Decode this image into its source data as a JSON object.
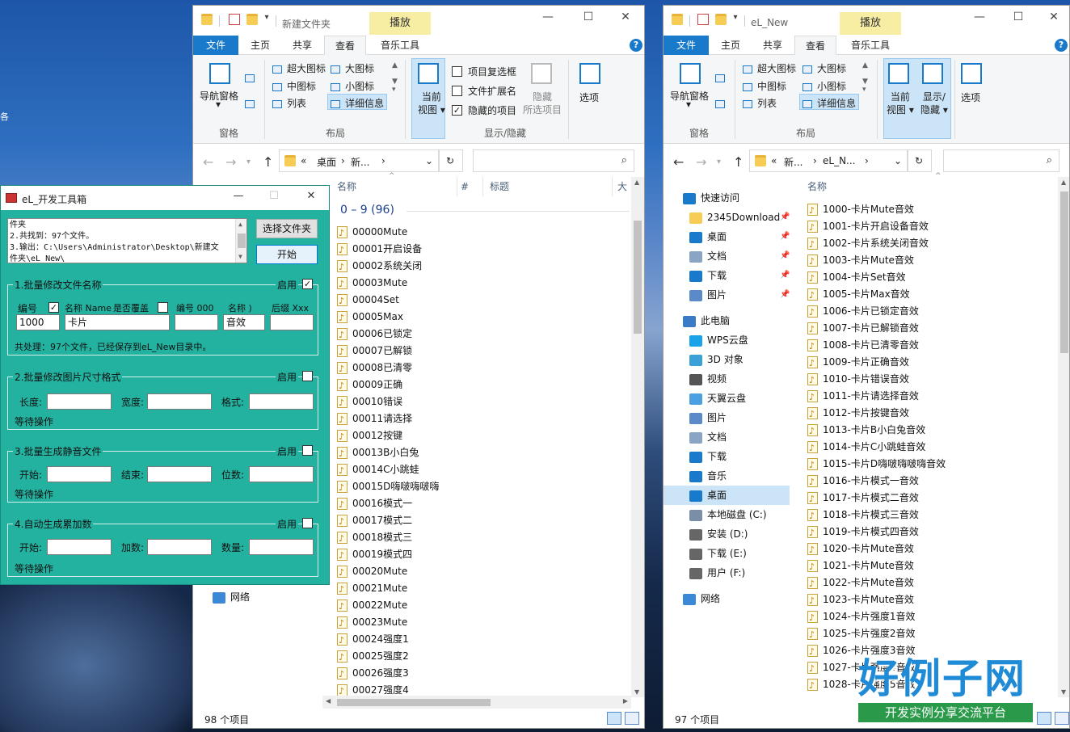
{
  "desktop": {
    "glyph": "各"
  },
  "explorer_left": {
    "title": "新建文件夹",
    "context_tab": "播放",
    "tabs": [
      "文件",
      "主页",
      "共享",
      "查看",
      "音乐工具"
    ],
    "ribbon": {
      "nav_pane": "导航窗格",
      "layout": [
        "超大图标",
        "大图标",
        "中图标",
        "小图标",
        "列表",
        "详细信息"
      ],
      "current_view": [
        "当前",
        "视图"
      ],
      "checkboxes": [
        "项目复选框",
        "文件扩展名",
        "隐藏的项目"
      ],
      "hide_selected": [
        "隐藏",
        "所选项目"
      ],
      "options": "选项",
      "groups": [
        "窗格",
        "布局",
        "显示/隐藏"
      ]
    },
    "breadcrumb": [
      "«",
      "桌面",
      "新..."
    ],
    "columns": [
      "名称",
      "#",
      "标题",
      "大"
    ],
    "group_header": "0 – 9 (96)",
    "files": [
      "00000Mute",
      "00001开启设备",
      "00002系统关闭",
      "00003Mute",
      "00004Set",
      "00005Max",
      "00006已锁定",
      "00007已解锁",
      "00008已清零",
      "00009正确",
      "00010错误",
      "00011请选择",
      "00012按键",
      "00013B小白兔",
      "00014C小跳蛙",
      "00015D嗨啵嗨啵嗨",
      "00016模式一",
      "00017模式二",
      "00018模式三",
      "00019模式四",
      "00020Mute",
      "00021Mute",
      "00022Mute",
      "00023Mute",
      "00024强度1",
      "00025强度2",
      "00026强度3",
      "00027强度4"
    ],
    "nav_network": "网络",
    "status": "98 个项目"
  },
  "explorer_right": {
    "title": "eL_New",
    "context_tab": "播放",
    "tabs": [
      "文件",
      "主页",
      "共享",
      "查看",
      "音乐工具"
    ],
    "ribbon": {
      "nav_pane": "导航窗格",
      "layout": [
        "超大图标",
        "大图标",
        "中图标",
        "小图标",
        "列表",
        "详细信息"
      ],
      "current_view": [
        "当前",
        "视图"
      ],
      "show_hide": [
        "显示/",
        "隐藏"
      ],
      "options": "选项",
      "groups": [
        "窗格",
        "布局"
      ]
    },
    "breadcrumb": [
      "«",
      "新...",
      "eL_N..."
    ],
    "columns": [
      "名称"
    ],
    "nav": [
      "快速访问",
      "2345Download",
      "桌面",
      "文档",
      "下载",
      "图片",
      "此电脑",
      "WPS云盘",
      "3D 对象",
      "视频",
      "天翼云盘",
      "图片",
      "文档",
      "下载",
      "音乐",
      "桌面",
      "本地磁盘 (C:)",
      "安装 (D:)",
      "下载 (E:)",
      "用户 (F:)",
      "网络"
    ],
    "files": [
      "1000-卡片Mute音效",
      "1001-卡片开启设备音效",
      "1002-卡片系统关闭音效",
      "1003-卡片Mute音效",
      "1004-卡片Set音效",
      "1005-卡片Max音效",
      "1006-卡片已锁定音效",
      "1007-卡片已解锁音效",
      "1008-卡片已清零音效",
      "1009-卡片正确音效",
      "1010-卡片错误音效",
      "1011-卡片请选择音效",
      "1012-卡片按键音效",
      "1013-卡片B小白兔音效",
      "1014-卡片C小跳蛙音效",
      "1015-卡片D嗨啵嗨啵嗨音效",
      "1016-卡片模式一音效",
      "1017-卡片模式二音效",
      "1018-卡片模式三音效",
      "1019-卡片模式四音效",
      "1020-卡片Mute音效",
      "1021-卡片Mute音效",
      "1022-卡片Mute音效",
      "1023-卡片Mute音效",
      "1024-卡片强度1音效",
      "1025-卡片强度2音效",
      "1026-卡片强度3音效",
      "1027-卡片强度4音效",
      "1028-卡片强度5音效"
    ],
    "status": "97 个项目"
  },
  "tool": {
    "title": "eL_开发工具箱",
    "log": [
      "件夹",
      "2.共找到：97个文件。",
      "3.输出：C:\\Users\\Administrator\\Desktop\\新建文",
      "件夹\\eL_New\\"
    ],
    "btn_select": "选择文件夹",
    "btn_start": "开始",
    "enable_label": "启用",
    "g1": {
      "title": "1.批量修改文件名称",
      "labels": [
        "编号",
        "名称 Name",
        "是否覆盖",
        "编号 000",
        "名称 )",
        "后缀 Xxx"
      ],
      "inputs": [
        "1000",
        "卡片",
        "",
        "音效",
        ""
      ],
      "status": "共处理：97个文件，已经保存到eL_New目录中。"
    },
    "g2": {
      "title": "2.批量修改图片尺寸格式",
      "labels": [
        "长度:",
        "宽度:",
        "格式:"
      ],
      "status": "等待操作"
    },
    "g3": {
      "title": "3.批量生成静音文件",
      "labels": [
        "开始:",
        "结束:",
        "位数:"
      ],
      "status": "等待操作"
    },
    "g4": {
      "title": "4.自动生成累加数",
      "labels": [
        "开始:",
        "加数:",
        "数量:"
      ],
      "status": "等待操作"
    }
  },
  "watermark": {
    "big": "好例子网",
    "sub": "开发实例分享交流平台"
  }
}
